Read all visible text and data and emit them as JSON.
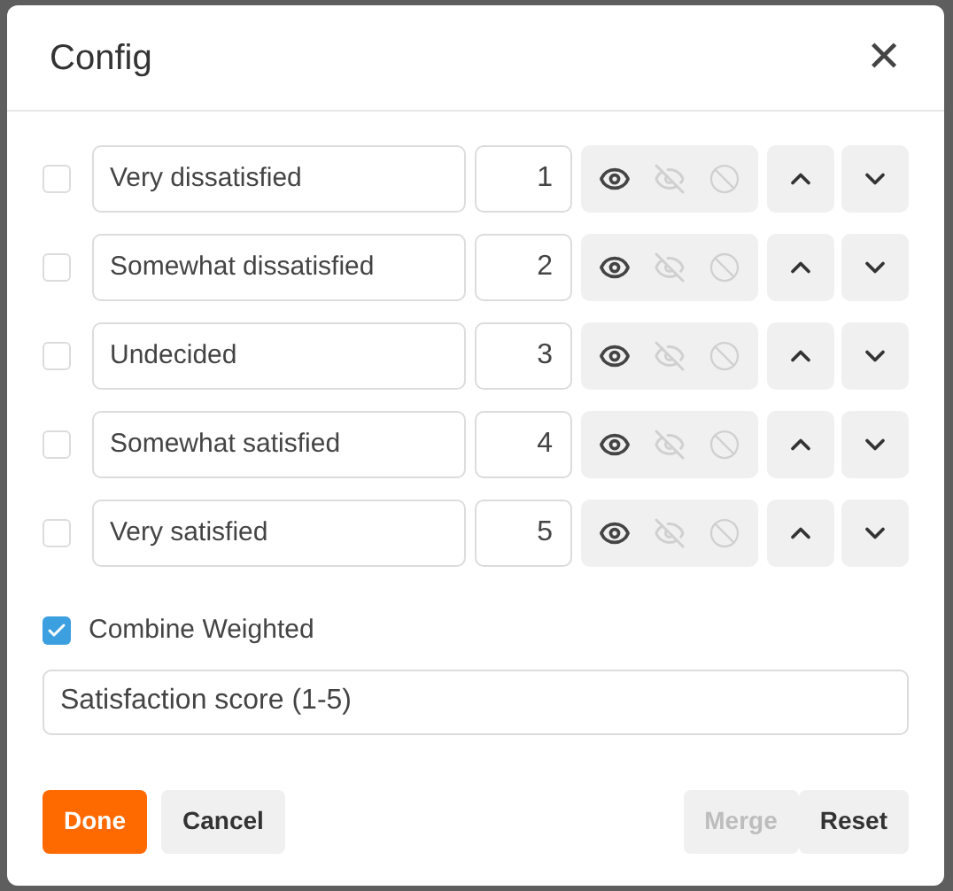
{
  "dialog": {
    "title": "Config",
    "close_label": "✕"
  },
  "rows": [
    {
      "checked": false,
      "label": "Very dissatisfied",
      "number": "1",
      "show_disabled": false,
      "hide_disabled": true,
      "exclude_disabled": true
    },
    {
      "checked": false,
      "label": "Somewhat dissatisfied",
      "number": "2",
      "show_disabled": false,
      "hide_disabled": true,
      "exclude_disabled": true
    },
    {
      "checked": false,
      "label": "Undecided",
      "number": "3",
      "show_disabled": false,
      "hide_disabled": true,
      "exclude_disabled": true
    },
    {
      "checked": false,
      "label": "Somewhat satisfied",
      "number": "4",
      "show_disabled": false,
      "hide_disabled": true,
      "exclude_disabled": true
    },
    {
      "checked": false,
      "label": "Very satisfied",
      "number": "5",
      "show_disabled": false,
      "hide_disabled": true,
      "exclude_disabled": true
    }
  ],
  "combine": {
    "label": "Combine Weighted",
    "checked": true
  },
  "name_field": {
    "value": "Satisfaction score (1-5)"
  },
  "buttons": [
    {
      "label": "Done",
      "kind": "primary",
      "disabled": false
    },
    {
      "label": "Cancel",
      "kind": "secondary",
      "disabled": false
    },
    {
      "label": "Merge",
      "kind": "secondary",
      "disabled": true
    },
    {
      "label": "Reset",
      "kind": "secondary",
      "disabled": false
    }
  ]
}
